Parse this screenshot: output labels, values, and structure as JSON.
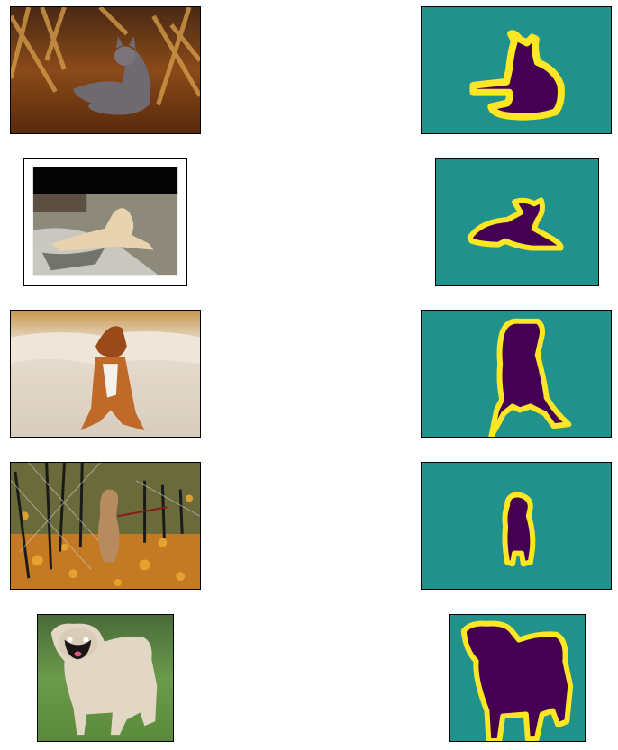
{
  "figure": {
    "rows": [
      {
        "photo_subject": "cat",
        "mask_subject": "cat"
      },
      {
        "photo_subject": "chihuahua",
        "mask_subject": "chihuahua"
      },
      {
        "photo_subject": "boxer",
        "mask_subject": "boxer"
      },
      {
        "photo_subject": "terrier",
        "mask_subject": "terrier"
      },
      {
        "photo_subject": "pug",
        "mask_subject": "pug"
      }
    ]
  },
  "colors": {
    "background": "#21918c",
    "foreground": "#440154",
    "boundary": "#fde725"
  }
}
